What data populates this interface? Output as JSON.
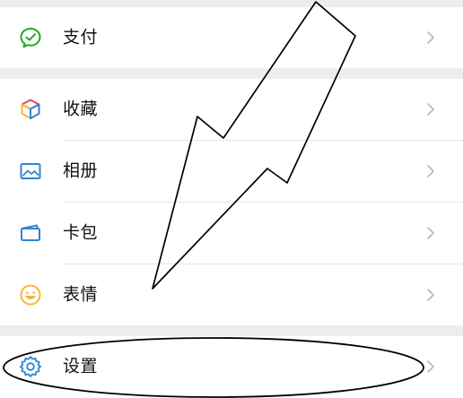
{
  "menu": {
    "items": [
      {
        "label": "支付",
        "icon": "wechat-pay-icon",
        "color": "#1aad19"
      },
      {
        "label": "收藏",
        "icon": "favorites-cube-icon",
        "color": "#f0a03c"
      },
      {
        "label": "相册",
        "icon": "album-icon",
        "color": "#2f83d6"
      },
      {
        "label": "卡包",
        "icon": "card-wallet-icon",
        "color": "#2f83d6"
      },
      {
        "label": "表情",
        "icon": "sticker-smiley-icon",
        "color": "#f5b733"
      },
      {
        "label": "设置",
        "icon": "settings-gear-icon",
        "color": "#2f83d6"
      }
    ]
  },
  "colors": {
    "separator_band": "#ededed",
    "divider": "#e6e6e6",
    "chevron": "#b8b8b8",
    "annotation_stroke": "#000000"
  },
  "annotation": {
    "arrow_icon": "hand-drawn-arrow",
    "ellipse_icon": "hand-drawn-ellipse-highlight"
  }
}
